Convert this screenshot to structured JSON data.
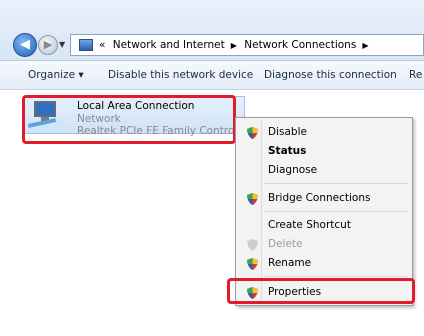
{
  "address": {
    "prefix": "«",
    "crumbs": [
      "Network and Internet",
      "Network Connections"
    ]
  },
  "toolbar": {
    "organize": "Organize ▾",
    "disable": "Disable this network device",
    "diagnose": "Diagnose this connection",
    "more": "Re"
  },
  "connection": {
    "name": "Local Area Connection",
    "status": "Network",
    "adapter": "Realtek PCIe FE Family Controller"
  },
  "menu": {
    "items": [
      {
        "label": "Disable",
        "shield": true
      },
      {
        "label": "Status",
        "bold": true
      },
      {
        "label": "Diagnose"
      },
      {
        "label": "Bridge Connections",
        "shield": true
      },
      {
        "label": "Create Shortcut"
      },
      {
        "label": "Delete",
        "shield": true,
        "disabled": true
      },
      {
        "label": "Rename",
        "shield": true
      },
      {
        "label": "Properties",
        "shield": true
      }
    ]
  },
  "colors": {
    "highlight": "#e11d2b",
    "selection": "#cfe2f7"
  }
}
